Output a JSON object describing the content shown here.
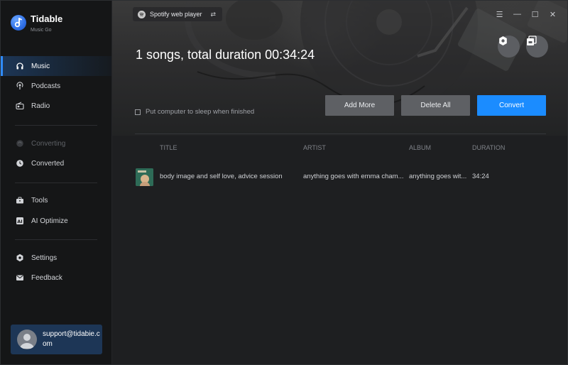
{
  "app": {
    "name": "Tidable",
    "subtitle": "Music Go"
  },
  "sidebar": {
    "items": [
      {
        "label": "Music",
        "icon": "headphones-icon",
        "state": "active"
      },
      {
        "label": "Podcasts",
        "icon": "podcast-icon",
        "state": "normal"
      },
      {
        "label": "Radio",
        "icon": "radio-icon",
        "state": "normal"
      },
      {
        "label": "Converting",
        "icon": "converting-icon",
        "state": "disabled"
      },
      {
        "label": "Converted",
        "icon": "clock-icon",
        "state": "normal"
      },
      {
        "label": "Tools",
        "icon": "toolbox-icon",
        "state": "normal"
      },
      {
        "label": "AI Optimize",
        "icon": "ai-icon",
        "state": "normal"
      },
      {
        "label": "Settings",
        "icon": "gear-icon",
        "state": "normal"
      },
      {
        "label": "Feedback",
        "icon": "mail-icon",
        "state": "normal"
      }
    ],
    "account": {
      "email": "support@tidabie.com"
    }
  },
  "header": {
    "source": "Spotify web player",
    "headline": "1 songs, total duration 00:34:24"
  },
  "options": {
    "sleep_label": "Put computer to sleep when finished",
    "sleep_checked": false
  },
  "actions": {
    "add_more": "Add More",
    "delete_all": "Delete All",
    "convert": "Convert"
  },
  "table": {
    "columns": [
      "TITLE",
      "ARTIST",
      "ALBUM",
      "DURATION"
    ],
    "rows": [
      {
        "title": "body image and self love, advice session",
        "artist": "anything goes with emma cham...",
        "album": "anything goes wit...",
        "duration": "34:24"
      }
    ]
  },
  "colors": {
    "accent": "#1b8cff",
    "sidebar_active": "#1d3656",
    "background": "#1e1f21"
  }
}
